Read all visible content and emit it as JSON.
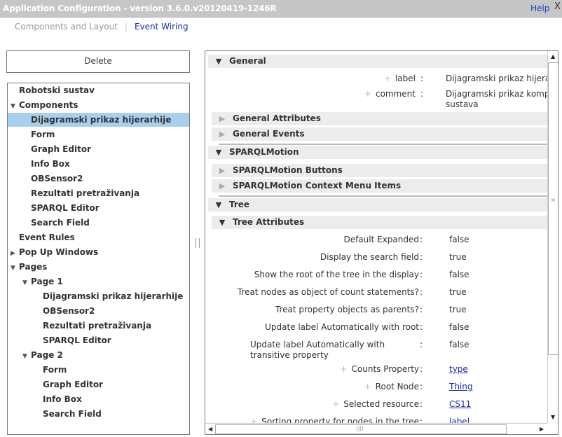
{
  "window": {
    "title": "Application Configuration - version 3.6.0.v20120419-1246R",
    "help": "Help",
    "close": "X"
  },
  "tabs": [
    {
      "label": "Components and Layout",
      "active": false
    },
    {
      "label": "Event Wiring",
      "active": true
    }
  ],
  "tab_separator": "|",
  "delete_button": "Delete",
  "tree": [
    {
      "label": "Robotski sustav",
      "level": 0,
      "arrow": ""
    },
    {
      "label": "Components",
      "level": 0,
      "arrow": "▼"
    },
    {
      "label": "Dijagramski prikaz hijerarhije",
      "level": 1,
      "arrow": "",
      "selected": true
    },
    {
      "label": "Form",
      "level": 1,
      "arrow": ""
    },
    {
      "label": "Graph Editor",
      "level": 1,
      "arrow": ""
    },
    {
      "label": "Info Box",
      "level": 1,
      "arrow": ""
    },
    {
      "label": "OBSensor2",
      "level": 1,
      "arrow": ""
    },
    {
      "label": "Rezultati pretraživanja",
      "level": 1,
      "arrow": ""
    },
    {
      "label": "SPARQL Editor",
      "level": 1,
      "arrow": ""
    },
    {
      "label": "Search Field",
      "level": 1,
      "arrow": ""
    },
    {
      "label": "Event Rules",
      "level": 0,
      "arrow": ""
    },
    {
      "label": "Pop Up Windows",
      "level": 0,
      "arrow": "▶"
    },
    {
      "label": "Pages",
      "level": 0,
      "arrow": "▼"
    },
    {
      "label": "Page 1",
      "level": 1,
      "arrow": "▼"
    },
    {
      "label": "Dijagramski prikaz hijerarhije",
      "level": 2,
      "arrow": ""
    },
    {
      "label": "OBSensor2",
      "level": 2,
      "arrow": ""
    },
    {
      "label": "Rezultati pretraživanja",
      "level": 2,
      "arrow": ""
    },
    {
      "label": "SPARQL Editor",
      "level": 2,
      "arrow": ""
    },
    {
      "label": "Page 2",
      "level": 1,
      "arrow": "▼"
    },
    {
      "label": "Form",
      "level": 2,
      "arrow": ""
    },
    {
      "label": "Graph Editor",
      "level": 2,
      "arrow": ""
    },
    {
      "label": "Info Box",
      "level": 2,
      "arrow": ""
    },
    {
      "label": "Search Field",
      "level": 2,
      "arrow": ""
    }
  ],
  "properties": {
    "general": {
      "title": "General",
      "label_key": "label",
      "label_value": "Dijagramski prikaz hijerarhije",
      "comment_key": "comment",
      "comment_value": "Dijagramski prikaz komponenti",
      "comment_value2": "sustava"
    },
    "general_attributes": "General Attributes",
    "general_events": "General Events",
    "sparqlmotion": "SPARQLMotion",
    "sparqlmotion_buttons": "SPARQLMotion Buttons",
    "sparqlmotion_context": "SPARQLMotion Context Menu Items",
    "tree": "Tree",
    "tree_attributes": "Tree Attributes",
    "colon": ":",
    "rows": [
      {
        "label": "Default Expanded",
        "value": "false"
      },
      {
        "label": "Display the search field",
        "value": "true"
      },
      {
        "label": "Show the root of the tree in the display",
        "value": "false"
      },
      {
        "label": "Treat nodes as object of count statements?",
        "value": "true"
      },
      {
        "label": "Treat property objects as parents?",
        "value": "true"
      },
      {
        "label": "Update label Automatically with root",
        "value": "false"
      },
      {
        "label": "Update label Automatically with transitive property",
        "value": "false",
        "multiline": true
      },
      {
        "label": "Counts Property",
        "value": "type",
        "link": true,
        "plus": true
      },
      {
        "label": "Root Node",
        "value": "Thing",
        "link": true,
        "plus": true
      },
      {
        "label": "Selected resource",
        "value": "CS11",
        "link": true,
        "plus": true
      },
      {
        "label": "Sorting property for nodes in the tree",
        "value": "label",
        "link": true,
        "plus": true
      }
    ]
  }
}
